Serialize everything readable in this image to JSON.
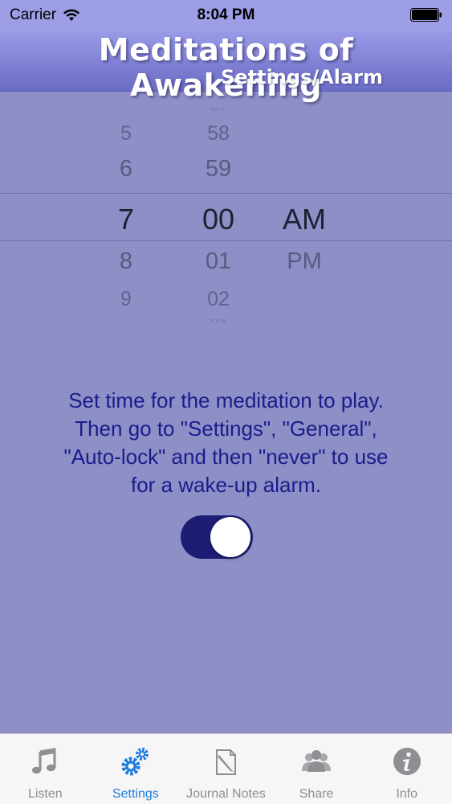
{
  "status_bar": {
    "carrier": "Carrier",
    "time": "8:04 PM"
  },
  "header": {
    "title": "Meditations of Awakening",
    "subtitle": "Settings/Alarm"
  },
  "picker": {
    "hours": [
      "",
      "5",
      "6",
      "7",
      "8",
      "9",
      ""
    ],
    "minutes": [
      "57",
      "58",
      "59",
      "00",
      "01",
      "02",
      "03"
    ],
    "periods": [
      "AM",
      "PM"
    ],
    "selected": {
      "hour": "7",
      "minute": "00",
      "period": "AM"
    }
  },
  "instructions": {
    "line1": "Set time for the meditation to play.",
    "line2": "Then go to \"Settings\", \"General\",",
    "line3": "\"Auto-lock\" and then \"never\" to use",
    "line4": "for a wake-up alarm."
  },
  "alarm_toggle": {
    "on": true
  },
  "tabs": [
    {
      "label": "Listen",
      "icon": "music-note-icon",
      "active": false
    },
    {
      "label": "Settings",
      "icon": "gears-icon",
      "active": true
    },
    {
      "label": "Journal Notes",
      "icon": "note-pencil-icon",
      "active": false
    },
    {
      "label": "Share",
      "icon": "people-icon",
      "active": false
    },
    {
      "label": "Info",
      "icon": "info-icon",
      "active": false
    }
  ],
  "colors": {
    "background": "#8d8fc6",
    "header_top": "#9a9be8",
    "header_bottom": "#6b6cc4",
    "instruction_text": "#1a1c8c",
    "toggle_on": "#1c1d73",
    "tab_active": "#1b7be0",
    "tab_inactive": "#8e8e93"
  }
}
